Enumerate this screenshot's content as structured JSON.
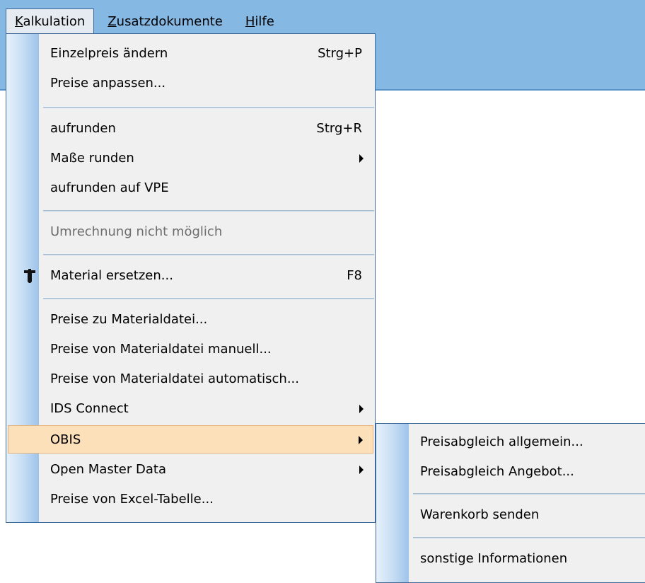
{
  "menubar": {
    "items": [
      {
        "accel": "K",
        "rest": "alkulation"
      },
      {
        "accel": "Z",
        "rest": "usatzdokumente"
      },
      {
        "accel": "H",
        "rest": "ilfe"
      }
    ]
  },
  "kalkulation_menu": {
    "items": [
      {
        "label": "Einzelpreis ändern",
        "shortcut": "Strg+P"
      },
      {
        "label": "Preise anpassen..."
      },
      {
        "label": "aufrunden",
        "shortcut": "Strg+R"
      },
      {
        "label": "Maße runden"
      },
      {
        "label": "aufrunden auf VPE"
      },
      {
        "label": "Umrechnung nicht möglich"
      },
      {
        "label": "Material ersetzen...",
        "shortcut": "F8",
        "icon": "wrench-icon"
      },
      {
        "label": "Preise zu Materialdatei..."
      },
      {
        "label": "Preise von Materialdatei manuell..."
      },
      {
        "label": "Preise von Materialdatei automatisch..."
      },
      {
        "label": "IDS Connect"
      },
      {
        "label": "OBIS"
      },
      {
        "label": "Open Master Data"
      },
      {
        "label": "Preise von Excel-Tabelle..."
      }
    ]
  },
  "obis_submenu": {
    "items": [
      {
        "label": "Preisabgleich allgemein..."
      },
      {
        "label": "Preisabgleich Angebot..."
      },
      {
        "label": "Warenkorb senden"
      },
      {
        "label": "sonstige Informationen"
      }
    ]
  },
  "colors": {
    "titlebar": "#86b8e4",
    "menu_bg": "#f0f0f0",
    "menu_border": "#3e6998",
    "highlight_bg": "#fbe0ba",
    "disabled_text": "#6d6d6d"
  }
}
